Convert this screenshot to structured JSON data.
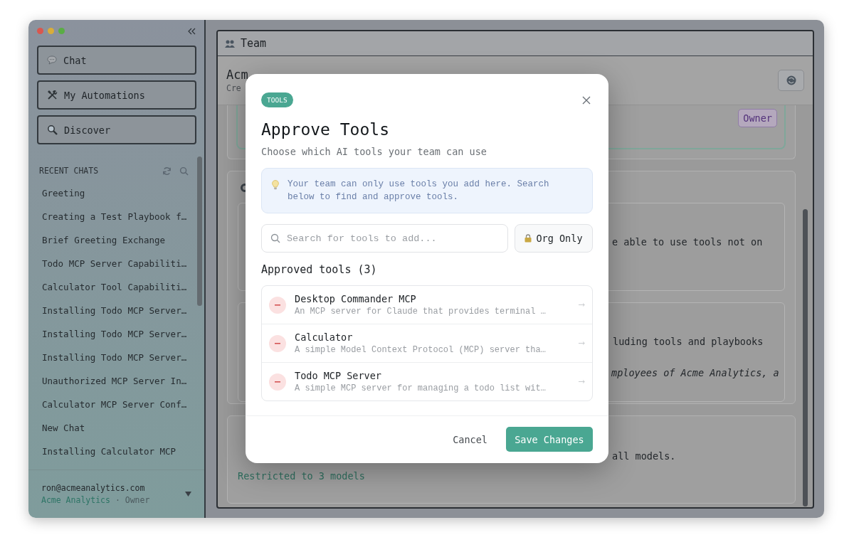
{
  "sidebar": {
    "nav": [
      {
        "label": "Chat"
      },
      {
        "label": "My Automations"
      },
      {
        "label": "Discover"
      }
    ],
    "recent_chats": {
      "title": "RECENT CHATS",
      "items": [
        "Greeting",
        "Creating a Test Playbook f…",
        "Brief Greeting Exchange",
        "Todo MCP Server Capabiliti…",
        "Calculator Tool Capabiliti…",
        "Installing Todo MCP Server…",
        "Installing Todo MCP Server…",
        "Installing Todo MCP Server…",
        "Unauthorized MCP Server In…",
        "Calculator MCP Server Conf…",
        "New Chat",
        "Installing Calculator MCP"
      ]
    },
    "account": {
      "email": "ron@acmeanalytics.com",
      "org": "Acme Analytics",
      "role": "· Owner"
    }
  },
  "main": {
    "header": {
      "title": "Team"
    },
    "org": {
      "name": "Acm",
      "subtitle": "Cre"
    },
    "member_badge": "Owner",
    "texts": [
      {
        "text": "e able to use tools not on",
        "italic": false
      },
      {
        "text": "luding tools and playbooks",
        "italic": false
      },
      {
        "text": "mployees of Acme Analytics, a",
        "italic": true
      },
      {
        "text": "all models.",
        "italic": false
      }
    ],
    "models_note": "Restricted to 3 models"
  },
  "modal": {
    "badge": "TOOLS",
    "title": "Approve Tools",
    "subtitle": "Choose which AI tools your team can use",
    "info": "Your team can only use tools you add here. Search below to find and approve tools.",
    "search": {
      "placeholder": "Search for tools to add..."
    },
    "org_only": "Org Only",
    "approved_heading": "Approved tools (3)",
    "tools": [
      {
        "name": "Desktop Commander MCP",
        "description": "An MCP server for Claude that provides terminal …"
      },
      {
        "name": "Calculator",
        "description": "A simple Model Context Protocol (MCP) server tha…"
      },
      {
        "name": "Todo MCP Server",
        "description": "A simple MCP server for managing a todo list wit…"
      }
    ],
    "cancel": "Cancel",
    "save": "Save Changes"
  }
}
